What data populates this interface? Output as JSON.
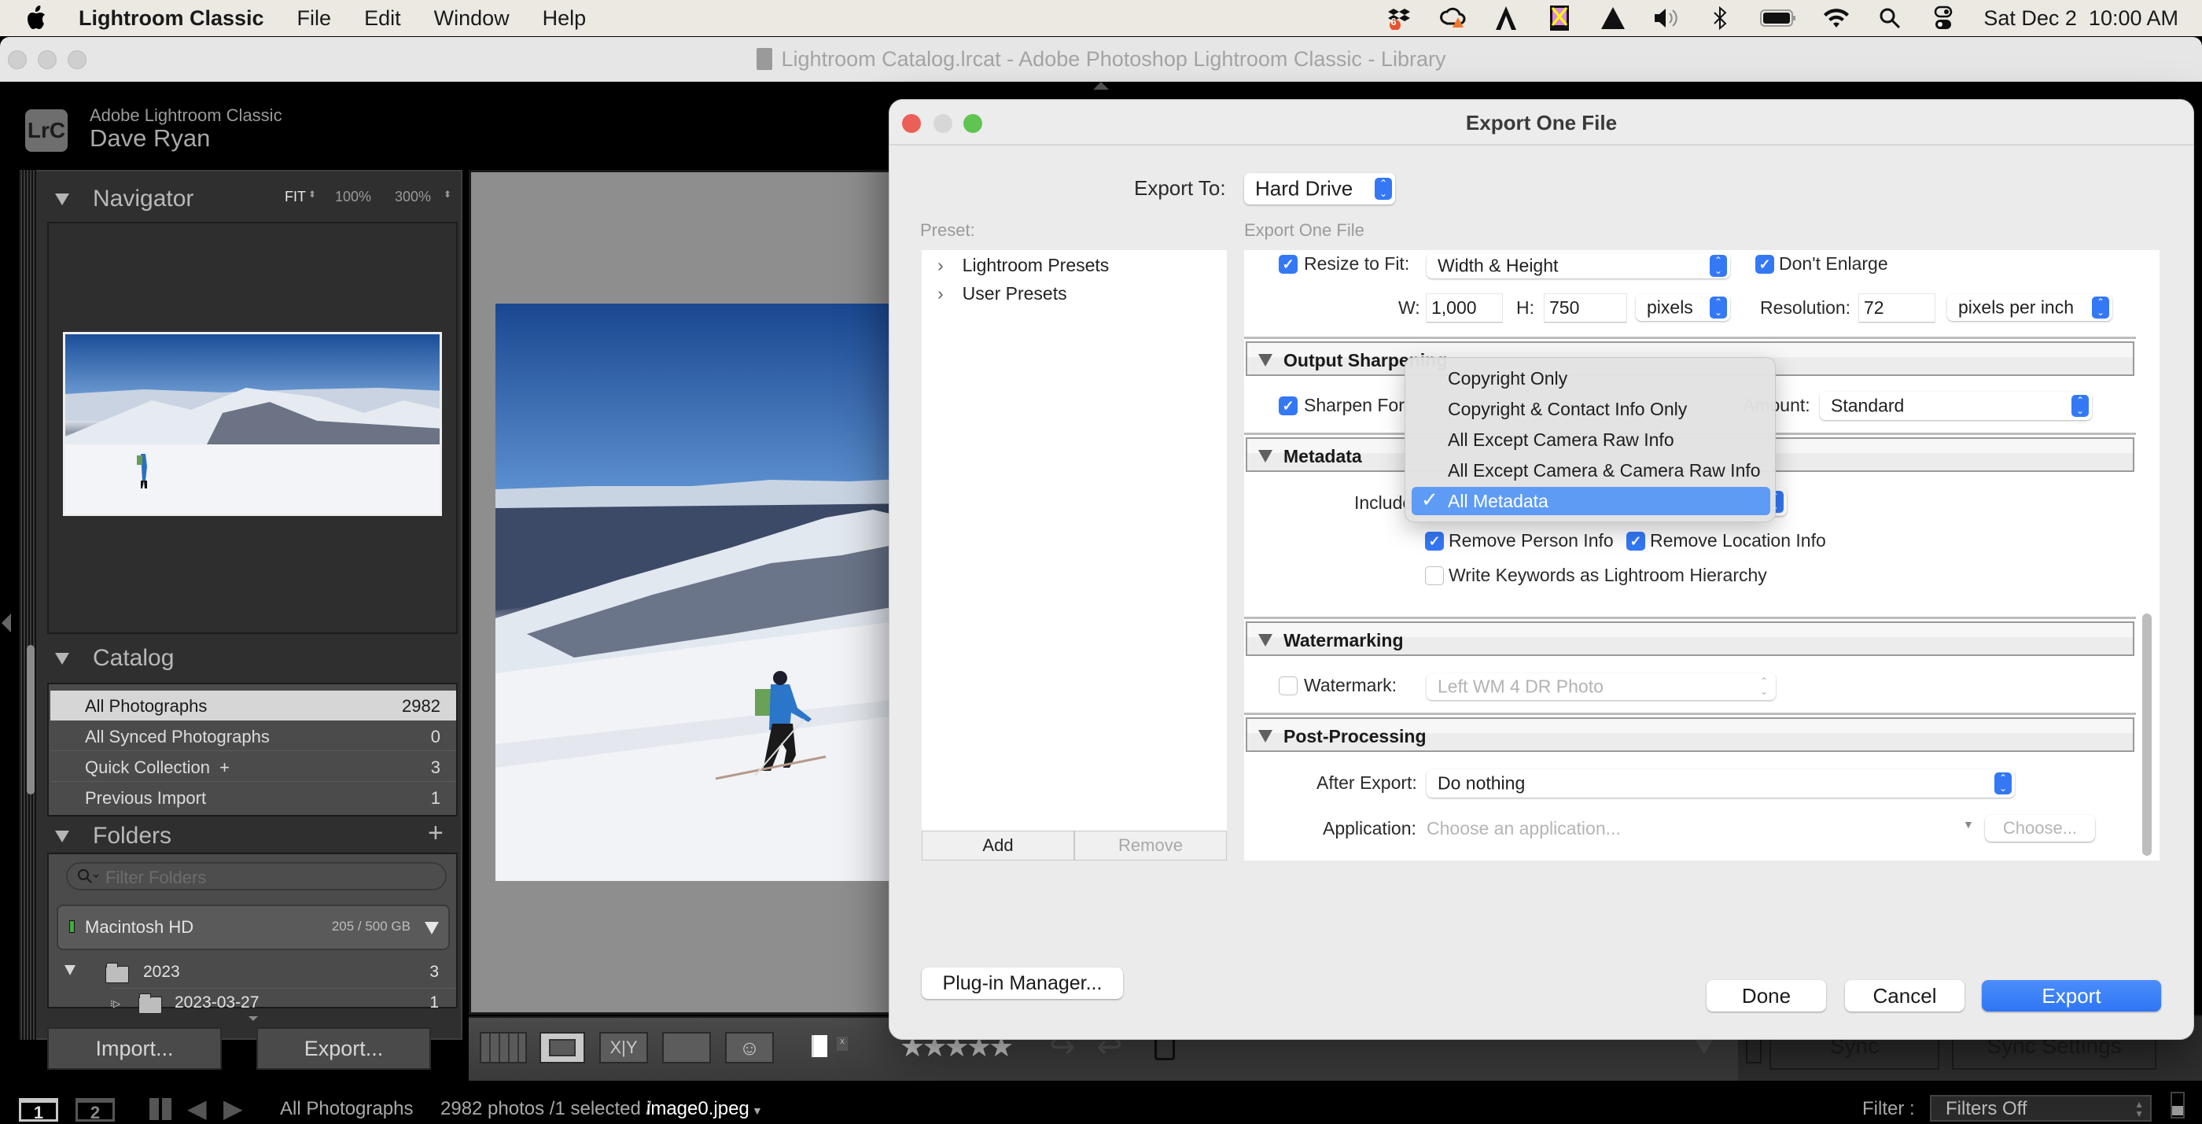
{
  "menubar": {
    "app_name": "Lightroom Classic",
    "items": [
      "File",
      "Edit",
      "Window",
      "Help"
    ],
    "status_icons": [
      "dropbox-icon",
      "creative-cloud-icon",
      "adobe-acrobat-icon",
      "nikon-icon",
      "google-drive-icon",
      "volume-icon",
      "bluetooth-icon",
      "battery-icon",
      "wifi-icon",
      "spotlight-search-icon",
      "control-center-icon"
    ],
    "dropbox_badge": "6",
    "clock": "Sat Dec 2  10:00 AM"
  },
  "window": {
    "title": "Lightroom Catalog.lrcat - Adobe Photoshop Lightroom Classic - Library"
  },
  "identity": {
    "logo": "LrC",
    "product": "Adobe Lightroom Classic",
    "user": "Dave Ryan"
  },
  "navigator": {
    "title": "Navigator",
    "zoom_fit": "FIT",
    "zoom_100": "100%",
    "zoom_300": "300%"
  },
  "catalog": {
    "title": "Catalog",
    "rows": [
      {
        "label": "All Photographs",
        "count": "2982",
        "selected": true
      },
      {
        "label": "All Synced Photographs",
        "count": "0"
      },
      {
        "label": "Quick Collection  +",
        "count": "3"
      },
      {
        "label": "Previous Import",
        "count": "1"
      }
    ]
  },
  "folders": {
    "title": "Folders",
    "add_icon": "+",
    "filter_placeholder": "Filter Folders",
    "volume": {
      "name": "Macintosh HD",
      "capacity": "205 / 500 GB"
    },
    "rows": [
      {
        "label": "2023",
        "count": "3"
      },
      {
        "label": "2023-03-27",
        "count": "1"
      }
    ]
  },
  "left_buttons": {
    "import": "Import...",
    "export": "Export..."
  },
  "right_panel": {
    "sync": "Sync",
    "sync_settings": "Sync Settings"
  },
  "filmstrip": {
    "screen1": "1",
    "screen2": "2",
    "source": "All Photographs",
    "info": "2982 photos /1 selected /",
    "filename": "image0.jpeg",
    "filter_label": "Filter :",
    "filter_value": "Filters Off"
  },
  "dialog": {
    "title": "Export One File",
    "export_to_label": "Export To:",
    "export_to_value": "Hard Drive",
    "preset_label": "Preset:",
    "settings_label": "Export One File",
    "presets": [
      "Lightroom Presets",
      "User Presets"
    ],
    "add": "Add",
    "remove": "Remove",
    "resize": {
      "checkbox_label": "Resize to Fit:",
      "checked": true,
      "mode": "Width & Height",
      "dont_enlarge_label": "Don't Enlarge",
      "dont_enlarge_checked": true,
      "w_label": "W:",
      "w_value": "1,000",
      "h_label": "H:",
      "h_value": "750",
      "unit": "pixels",
      "resolution_label": "Resolution:",
      "resolution_value": "72",
      "resolution_unit": "pixels per inch"
    },
    "output_sharpening": {
      "title": "Output Sharpening",
      "sharpen_for_label": "Sharpen For:",
      "checked": true,
      "amount_label": "Amount:",
      "amount_value": "Standard"
    },
    "metadata": {
      "title": "Metadata",
      "include_label": "Include:",
      "menu_options": [
        "Copyright Only",
        "Copyright & Contact Info Only",
        "All Except Camera Raw Info",
        "All Except Camera & Camera Raw Info",
        "All Metadata"
      ],
      "selected_option": "All Metadata",
      "remove_person_label": "Remove Person Info",
      "remove_person_checked": true,
      "remove_location_label": "Remove Location Info",
      "remove_location_checked": true,
      "write_keywords_label": "Write Keywords as Lightroom Hierarchy",
      "write_keywords_checked": false
    },
    "watermarking": {
      "title": "Watermarking",
      "watermark_label": "Watermark:",
      "checked": false,
      "value": "Left WM 4 DR Photo"
    },
    "post_processing": {
      "title": "Post-Processing",
      "after_export_label": "After Export:",
      "after_export_value": "Do nothing",
      "application_label": "Application:",
      "application_placeholder": "Choose an application...",
      "choose_button": "Choose..."
    },
    "plugin_manager": "Plug-in Manager...",
    "done": "Done",
    "cancel": "Cancel",
    "export": "Export"
  },
  "colors": {
    "accent_blue": "#3478f6",
    "menu_highlight": "#5e9bf5",
    "close_red": "#ec5f57",
    "zoom_green": "#5fc451"
  }
}
